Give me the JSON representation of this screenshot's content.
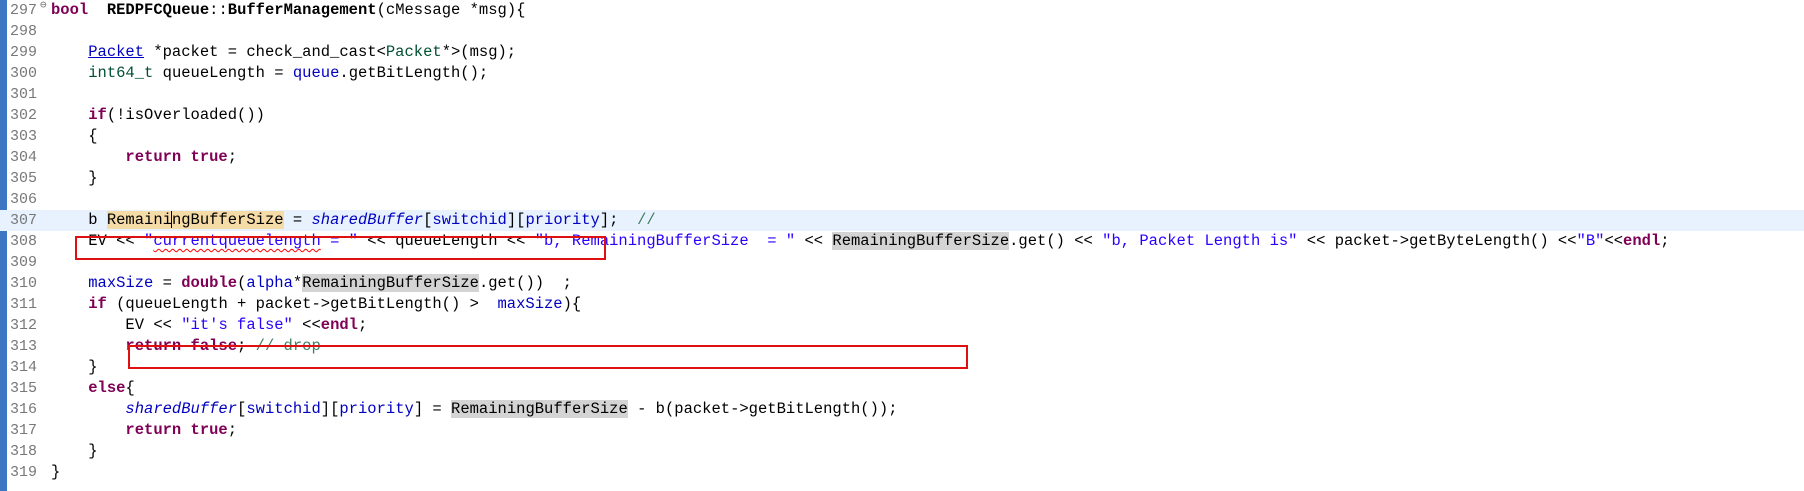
{
  "editor": {
    "lines": [
      {
        "n": "297",
        "fold": "⊖",
        "tokens": [
          [
            "kw",
            "bool"
          ],
          [
            "",
            "  "
          ],
          [
            "bold",
            "REDPFCQueue"
          ],
          [
            "",
            "::"
          ],
          [
            "bold",
            "BufferManagement"
          ],
          [
            "",
            "(cMessage *msg){"
          ]
        ]
      },
      {
        "n": "298",
        "tokens": []
      },
      {
        "n": "299",
        "tokens": [
          [
            "",
            "    "
          ],
          [
            "lnk",
            "Packet"
          ],
          [
            "",
            " *packet = check_and_cast<"
          ],
          [
            "ty",
            "Packet"
          ],
          [
            "",
            "*>(msg);"
          ]
        ]
      },
      {
        "n": "300",
        "tokens": [
          [
            "",
            "    "
          ],
          [
            "ty",
            "int64_t"
          ],
          [
            "",
            " queueLength = "
          ],
          [
            "fld",
            "queue"
          ],
          [
            "",
            ".getBitLength();"
          ]
        ]
      },
      {
        "n": "301",
        "tokens": []
      },
      {
        "n": "302",
        "tokens": [
          [
            "",
            "    "
          ],
          [
            "kw",
            "if"
          ],
          [
            "",
            "(!isOverloaded())"
          ]
        ]
      },
      {
        "n": "303",
        "tokens": [
          [
            "",
            "    {"
          ]
        ]
      },
      {
        "n": "304",
        "tokens": [
          [
            "",
            "        "
          ],
          [
            "kw",
            "return true"
          ],
          [
            "",
            ";"
          ]
        ]
      },
      {
        "n": "305",
        "tokens": [
          [
            "",
            "    }"
          ]
        ]
      },
      {
        "n": "306",
        "tokens": []
      },
      {
        "n": "307",
        "current": true,
        "tokens": [
          [
            "",
            "    b "
          ],
          [
            "occ-w",
            "Remaini"
          ],
          [
            "caret",
            ""
          ],
          [
            "occ-w",
            "ngBufferSize"
          ],
          [
            "",
            " = "
          ],
          [
            "ital",
            "sharedBuffer"
          ],
          [
            "",
            "["
          ],
          [
            "fld",
            "switchid"
          ],
          [
            "",
            "]["
          ],
          [
            "fld",
            "priority"
          ],
          [
            "",
            "];  "
          ],
          [
            "com",
            "//"
          ]
        ]
      },
      {
        "n": "308",
        "tokens": [
          [
            "",
            "    EV << "
          ],
          [
            "str",
            "\""
          ],
          [
            "str squig",
            "currentqueuelength"
          ],
          [
            "str",
            " = \""
          ],
          [
            "",
            " << queueLength << "
          ],
          [
            "str",
            "\"b, RemainingBufferSize  = \""
          ],
          [
            "",
            " << "
          ],
          [
            "occ",
            "RemainingBufferSize"
          ],
          [
            "",
            ".get() << "
          ],
          [
            "str",
            "\"b, Packet Length is\""
          ],
          [
            "",
            " << packet->getByteLength() <<"
          ],
          [
            "str",
            "\"B\""
          ],
          [
            "",
            "<<"
          ],
          [
            "kw",
            "endl"
          ],
          [
            "",
            ";"
          ]
        ]
      },
      {
        "n": "309",
        "tokens": []
      },
      {
        "n": "310",
        "tokens": [
          [
            "",
            "    "
          ],
          [
            "fld",
            "maxSize"
          ],
          [
            "",
            " = "
          ],
          [
            "kw",
            "double"
          ],
          [
            "",
            "("
          ],
          [
            "fld",
            "alpha"
          ],
          [
            "",
            "*"
          ],
          [
            "occ",
            "RemainingBufferSize"
          ],
          [
            "",
            ".get())  ;"
          ]
        ]
      },
      {
        "n": "311",
        "tokens": [
          [
            "",
            "    "
          ],
          [
            "kw",
            "if"
          ],
          [
            "",
            " (queueLength + packet->getBitLength() >  "
          ],
          [
            "fld",
            "maxSize"
          ],
          [
            "",
            "){"
          ]
        ]
      },
      {
        "n": "312",
        "tokens": [
          [
            "",
            "        EV << "
          ],
          [
            "str",
            "\"it's false\""
          ],
          [
            "",
            " <<"
          ],
          [
            "kw",
            "endl"
          ],
          [
            "",
            ";"
          ]
        ]
      },
      {
        "n": "313",
        "tokens": [
          [
            "",
            "        "
          ],
          [
            "kw",
            "return false"
          ],
          [
            "",
            "; "
          ],
          [
            "com",
            "// drop"
          ]
        ]
      },
      {
        "n": "314",
        "tokens": [
          [
            "",
            "    }"
          ]
        ]
      },
      {
        "n": "315",
        "tokens": [
          [
            "",
            "    "
          ],
          [
            "kw",
            "else"
          ],
          [
            "",
            "{"
          ]
        ]
      },
      {
        "n": "316",
        "tokens": [
          [
            "",
            "        "
          ],
          [
            "ital",
            "sharedBuffer"
          ],
          [
            "",
            "["
          ],
          [
            "fld",
            "switchid"
          ],
          [
            "",
            "]["
          ],
          [
            "fld",
            "priority"
          ],
          [
            "",
            "] = "
          ],
          [
            "occ",
            "RemainingBufferSize"
          ],
          [
            "",
            " - b(packet->getBitLength());"
          ]
        ]
      },
      {
        "n": "317",
        "tokens": [
          [
            "",
            "        "
          ],
          [
            "kw",
            "return true"
          ],
          [
            "",
            ";"
          ]
        ]
      },
      {
        "n": "318",
        "tokens": [
          [
            "",
            "    }"
          ]
        ]
      },
      {
        "n": "319",
        "tokens": [
          [
            "",
            "}"
          ]
        ]
      }
    ]
  },
  "colors": {
    "ruler": "#3d77c4",
    "current_line": "#e8f2fe",
    "highlight_box": "#e01010"
  }
}
